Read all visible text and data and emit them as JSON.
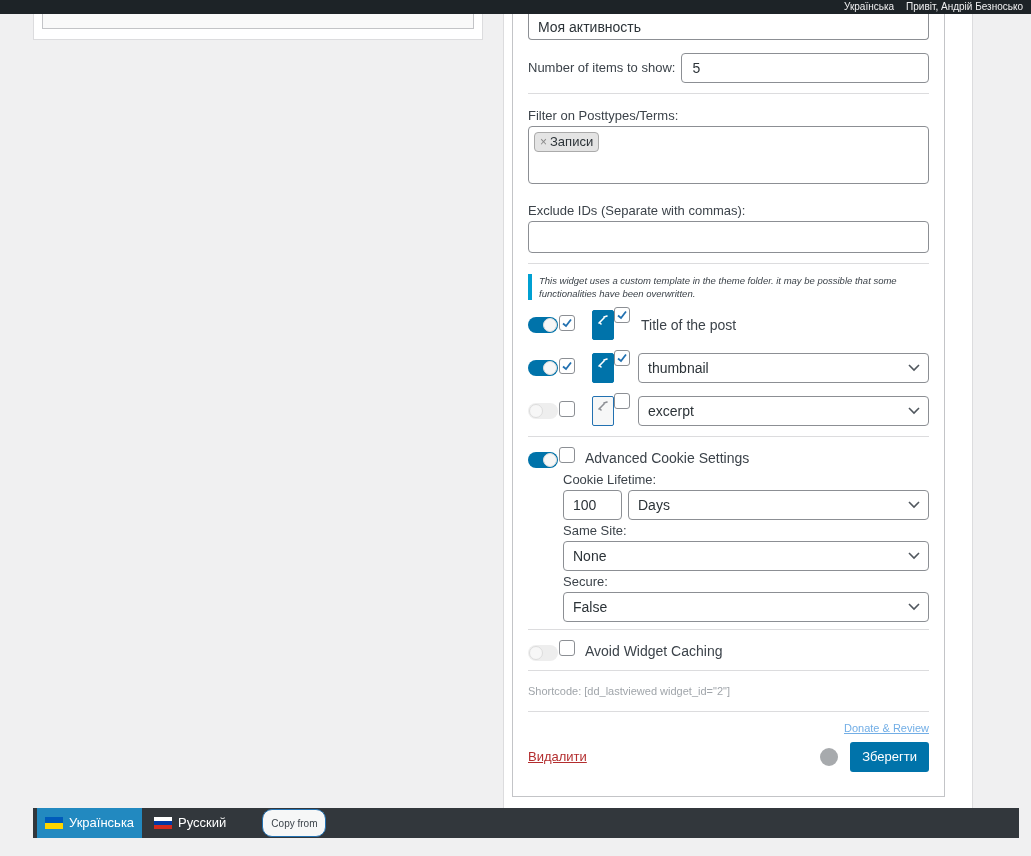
{
  "admin_bar": {
    "language": "Українська",
    "greeting": "Привіт, Андрій Безносько"
  },
  "widget": {
    "title_value": "Моя активность",
    "items_label": "Number of items to show:",
    "items_value": "5",
    "filter_label": "Filter on Posttypes/Terms:",
    "filter_tags": [
      {
        "label": "Записи",
        "remove": "×"
      }
    ],
    "exclude_label": "Exclude IDs (Separate with commas):",
    "notice": "This widget uses a custom template in the theme folder. it may be possible that some functionalities have been overwritten.",
    "fields": [
      {
        "kind": "text",
        "on": true,
        "checked": true,
        "linked": true,
        "link_checked": true,
        "label": "Title of the post"
      },
      {
        "kind": "select",
        "on": true,
        "checked": true,
        "linked": true,
        "link_checked": true,
        "value": "thumbnail"
      },
      {
        "kind": "select",
        "on": false,
        "checked": false,
        "linked": false,
        "link_checked": false,
        "value": "excerpt"
      }
    ],
    "cookie": {
      "on": true,
      "checked": false,
      "label": "Advanced Cookie Settings",
      "lifetime_label": "Cookie Lifetime:",
      "lifetime_value": "100",
      "lifetime_unit": "Days",
      "same_site_label": "Same Site:",
      "same_site": "None",
      "secure_label": "Secure:",
      "secure": "False"
    },
    "caching": {
      "on": false,
      "checked": false,
      "label": "Avoid Widget Caching"
    },
    "shortcode": "Shortcode: [dd_lastviewed widget_id=\"2\"]",
    "donate": "Donate & Review",
    "delete": "Видалити",
    "save": "Зберегти"
  },
  "language_bar": {
    "languages": [
      {
        "label": "Українська",
        "selected": true,
        "kind": "ua"
      },
      {
        "label": "Русский",
        "selected": false,
        "kind": "ru"
      }
    ],
    "copy": "Copy from"
  }
}
